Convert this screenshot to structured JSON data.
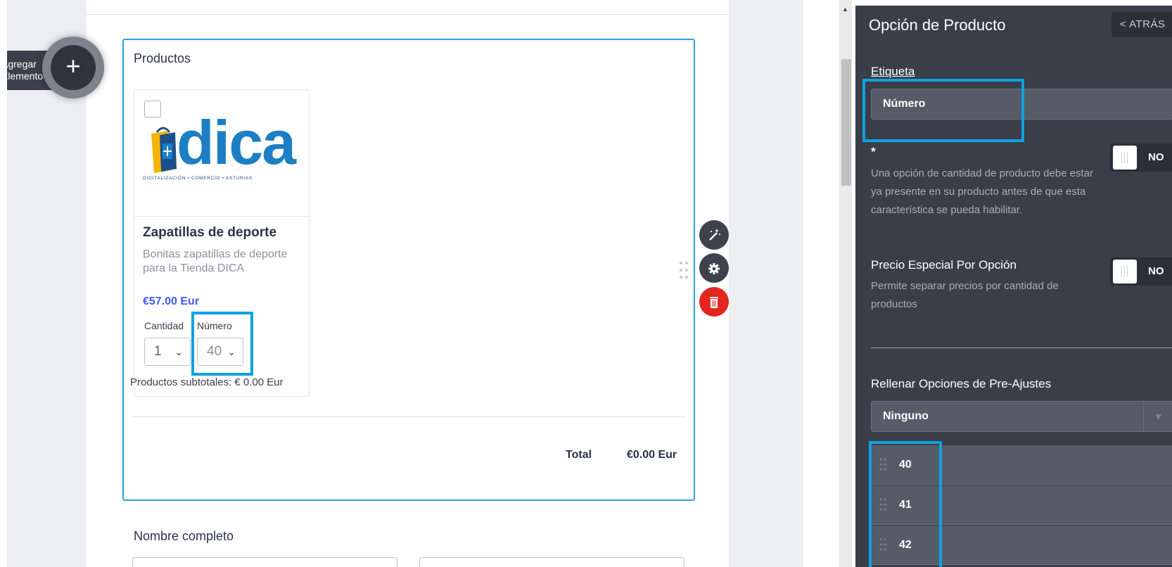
{
  "toolbar": {
    "add_element_label_line1": "Agregar",
    "add_element_label_line2": "Elemento",
    "add_icon": "+"
  },
  "product_block": {
    "title": "Productos",
    "product": {
      "logo_text": "dica",
      "logo_tagline": "DIGITALIZACIÓN • COMERCIO • ASTURIAS",
      "name": "Zapatillas de deporte",
      "description": "Bonitas zapatillas de deporte para la Tienda DICA",
      "price": "€57.00 Eur",
      "options": [
        {
          "label": "Cantidad",
          "value": "1"
        },
        {
          "label": "Número",
          "value": "40"
        }
      ],
      "subtotal": "Productos subtotales: € 0.00 Eur"
    },
    "total_label": "Total",
    "total_value": "€0.00 Eur"
  },
  "next_field": {
    "title": "Nombre completo"
  },
  "panel": {
    "title": "Opción de Producto",
    "back_label": "< ATRÁS",
    "label_field": {
      "label": "Etiqueta",
      "value": "Número"
    },
    "required": {
      "label": "*",
      "help": "Una opción de cantidad de producto debe estar ya presente en su producto antes de que esta característica se pueda habilitar.",
      "toggle": "NO"
    },
    "special_price": {
      "label": "Precio Especial Por Opción",
      "help": "Permite separar precios por cantidad de productos",
      "toggle": "NO"
    },
    "presets": {
      "label": "Rellenar Opciones de Pre-Ajustes",
      "selected": "Ninguno"
    },
    "option_values": [
      "40",
      "41",
      "42"
    ]
  },
  "colors": {
    "accent": "#0ea2e0",
    "panel_bg": "#393e48",
    "price": "#3d5bf5",
    "delete": "#e3261f"
  }
}
